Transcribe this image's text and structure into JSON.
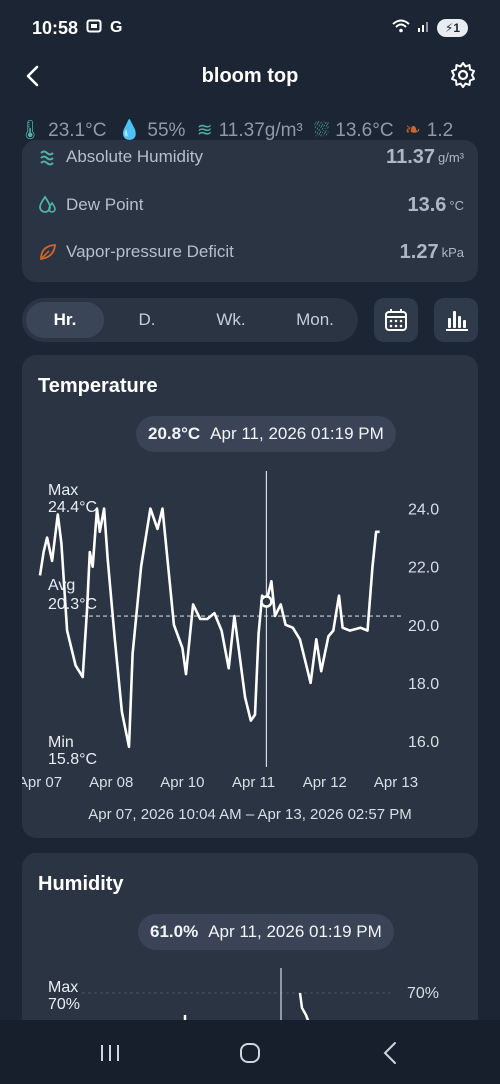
{
  "status_bar": {
    "time": "10:58",
    "carrier_glyph": "G",
    "battery_label": "1"
  },
  "app_bar": {
    "title": "bloom top"
  },
  "readings_strip": [
    "23.1°C",
    "55%",
    "11.37g/m³",
    "13.6°C",
    "1.2"
  ],
  "metrics": [
    {
      "label": "Absolute Humidity",
      "value": "11.37",
      "unit": "g/m³",
      "icon": "droplets-icon"
    },
    {
      "label": "Dew Point",
      "value": "13.6",
      "unit": "°C",
      "icon": "dew-point-icon"
    },
    {
      "label": "Vapor-pressure Deficit",
      "value": "1.27",
      "unit": "kPa",
      "icon": "leaf-icon"
    }
  ],
  "range_tabs": [
    {
      "label": "Hr.",
      "active": true
    },
    {
      "label": "D.",
      "active": false
    },
    {
      "label": "Wk.",
      "active": false
    },
    {
      "label": "Mon.",
      "active": false
    }
  ],
  "temperature": {
    "title": "Temperature",
    "tooltip_value": "20.8°C",
    "tooltip_time": "Apr 11, 2026 01:19 PM",
    "max_label": "Max",
    "max_value": "24.4°C",
    "avg_label": "Avg",
    "avg_value": "20.3°C",
    "min_label": "Min",
    "min_value": "15.8°C",
    "range_text": "Apr 07, 2026 10:04 AM – Apr 13, 2026 02:57 PM"
  },
  "humidity": {
    "title": "Humidity",
    "tooltip_value": "61.0%",
    "tooltip_time": "Apr 11, 2026 01:19 PM",
    "max_label": "Max",
    "max_value": "70%",
    "y_tick": "70%"
  },
  "chart_data": {
    "type": "line",
    "title": "Temperature",
    "unit": "°C",
    "ylim": [
      15,
      25.5
    ],
    "y_ticks": [
      16.0,
      18.0,
      20.0,
      22.0,
      24.0
    ],
    "y_tick_labels": [
      "16.0",
      "18.0",
      "20.0",
      "22.0",
      "24.0"
    ],
    "x_ticks": [
      "Apr 07",
      "Apr 08",
      "Apr 10",
      "Apr 11",
      "Apr 12",
      "Apr 13"
    ],
    "x_tick_pos": [
      0,
      1,
      2,
      3,
      4,
      5
    ],
    "avg": 20.3,
    "max": 24.4,
    "min": 15.8,
    "selected_x": 3.18,
    "selected_y": 20.8,
    "line_color": "#ffffff",
    "x": [
      0,
      0.05,
      0.1,
      0.17,
      0.25,
      0.3,
      0.38,
      0.5,
      0.6,
      0.66,
      0.7,
      0.74,
      0.8,
      0.84,
      0.9,
      0.95,
      1.05,
      1.15,
      1.25,
      1.3,
      1.42,
      1.55,
      1.65,
      1.72,
      1.8,
      1.88,
      2.0,
      2.05,
      2.15,
      2.25,
      2.35,
      2.45,
      2.55,
      2.65,
      2.73,
      2.88,
      2.96,
      3.02,
      3.07,
      3.12,
      3.18,
      3.25,
      3.3,
      3.38,
      3.45,
      3.55,
      3.65,
      3.72,
      3.8,
      3.88,
      3.95,
      4.05,
      4.12,
      4.2,
      4.25,
      4.35,
      4.5,
      4.6,
      4.67,
      4.72,
      4.77
    ],
    "y": [
      21.7,
      22.5,
      23.0,
      22.2,
      23.8,
      22.8,
      19.8,
      18.6,
      18.2,
      20.5,
      22.5,
      22.0,
      24.0,
      23.2,
      24.0,
      22.3,
      19.5,
      17.0,
      15.8,
      19.0,
      22.0,
      24.0,
      23.3,
      24.0,
      22.0,
      20.0,
      19.2,
      18.3,
      20.7,
      20.2,
      20.2,
      20.4,
      19.8,
      18.5,
      20.3,
      17.5,
      16.7,
      16.9,
      19.7,
      21.0,
      20.8,
      21.5,
      20.3,
      20.7,
      20.0,
      19.9,
      19.5,
      18.8,
      18.0,
      19.5,
      18.4,
      19.6,
      19.8,
      21.0,
      19.9,
      19.8,
      19.9,
      19.8,
      22.0,
      23.2,
      23.2
    ]
  }
}
